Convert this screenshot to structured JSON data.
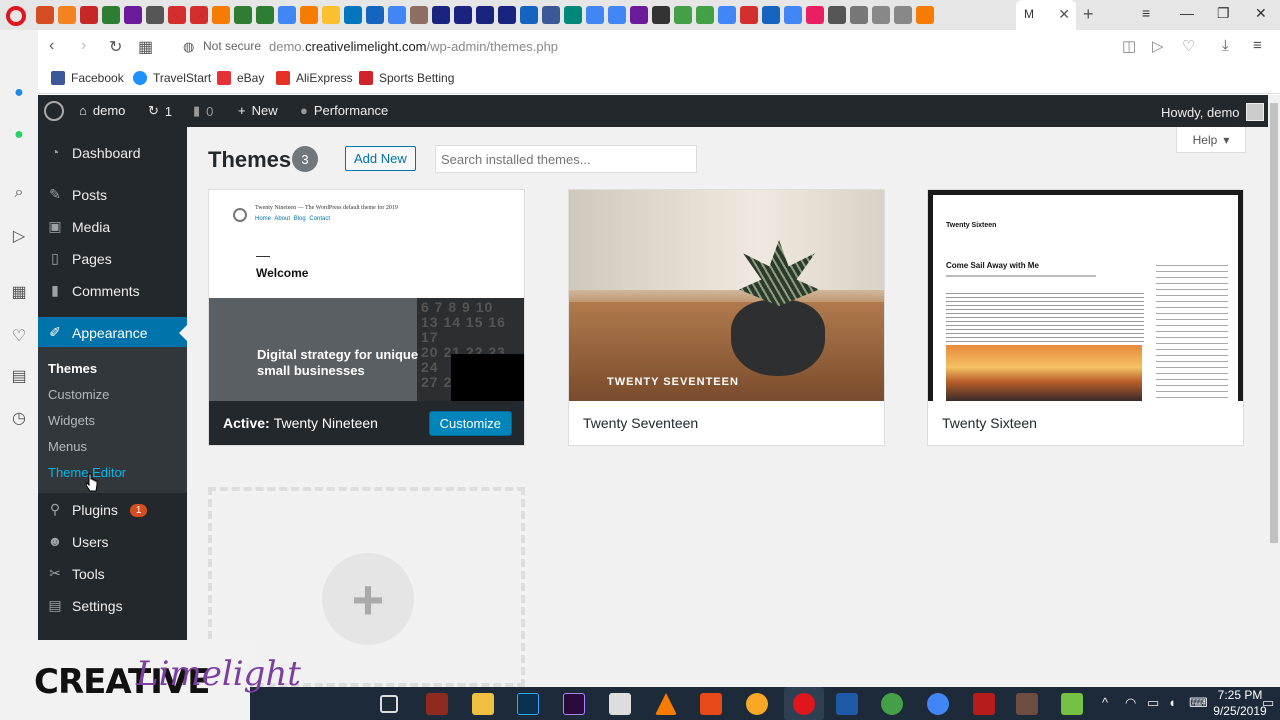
{
  "browser": {
    "active_tab_label": "M",
    "url_prefix": "demo.",
    "url_domain": "creativelimelight.com",
    "url_path": "/wp-admin/themes.php",
    "not_secure": "Not secure",
    "bookmarks": [
      {
        "label": "Facebook",
        "color": "#3b5998"
      },
      {
        "label": "TravelStart",
        "color": "#1e90ff"
      },
      {
        "label": "eBay",
        "color": "#e53238"
      },
      {
        "label": "AliExpress",
        "color": "#e43225"
      },
      {
        "label": "Sports Betting",
        "color": "#d2232a"
      }
    ]
  },
  "adminbar": {
    "site_name": "demo",
    "updates_count": "1",
    "comments_count": "0",
    "new_label": "New",
    "performance_label": "Performance",
    "howdy": "Howdy, demo"
  },
  "menu": {
    "items": [
      {
        "label": "Dashboard",
        "icon": "dashboard-icon"
      },
      {
        "label": "Posts",
        "icon": "pin-icon"
      },
      {
        "label": "Media",
        "icon": "media-icon"
      },
      {
        "label": "Pages",
        "icon": "page-icon"
      },
      {
        "label": "Comments",
        "icon": "comment-icon"
      },
      {
        "label": "Appearance",
        "icon": "brush-icon"
      },
      {
        "label": "Plugins",
        "icon": "plugin-icon"
      },
      {
        "label": "Users",
        "icon": "user-icon"
      },
      {
        "label": "Tools",
        "icon": "wrench-icon"
      },
      {
        "label": "Settings",
        "icon": "settings-icon"
      }
    ],
    "plugins_badge": "1",
    "submenu": [
      "Themes",
      "Customize",
      "Widgets",
      "Menus",
      "Theme Editor"
    ]
  },
  "main": {
    "help_label": "Help",
    "title": "Themes",
    "count": "3",
    "add_new": "Add New",
    "search_placeholder": "Search installed themes...",
    "themes": [
      {
        "prefix": "Active:",
        "name": "Twenty Nineteen",
        "action": "Customize"
      },
      {
        "name": "Twenty Seventeen"
      },
      {
        "name": "Twenty Sixteen"
      }
    ],
    "tn_header": "Twenty Nineteen — The WordPress default theme for 2019",
    "tn_nav": "Home  About  Blog  Contact",
    "tn_welcome": "Welcome",
    "tn_hero": "Digital strategy for unique small businesses",
    "ts_overlay": "TWENTY SEVENTEEN",
    "tsx_title": "Twenty Sixteen",
    "tsx_heading": "Come Sail Away with Me"
  },
  "taskbar": {
    "time": "7:25 PM",
    "date": "9/25/2019"
  },
  "watermark": {
    "word1": "CREATIVE",
    "word2": "Limelight"
  }
}
